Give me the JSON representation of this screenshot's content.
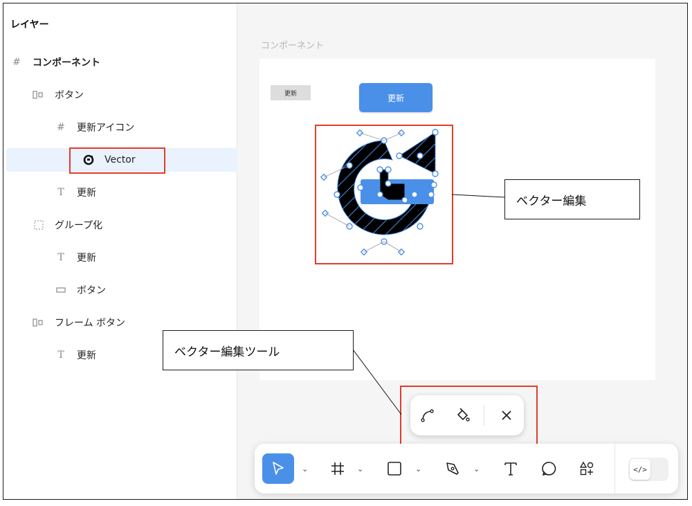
{
  "layers_panel": {
    "title": "レイヤー",
    "items": [
      {
        "label": "コンポーネント",
        "icon": "frame-icon"
      },
      {
        "label": "ボタン",
        "icon": "auto-layout-icon"
      },
      {
        "label": "更新アイコン",
        "icon": "frame-icon"
      },
      {
        "label": "Vector",
        "icon": "vector-icon"
      },
      {
        "label": "更新",
        "icon": "text-icon"
      },
      {
        "label": "グループ化",
        "icon": "group-icon"
      },
      {
        "label": "更新",
        "icon": "text-icon"
      },
      {
        "label": "ボタン",
        "icon": "rectangle-icon"
      },
      {
        "label": "フレーム ボタン",
        "icon": "auto-layout-icon"
      },
      {
        "label": "更新",
        "icon": "text-icon"
      }
    ]
  },
  "canvas": {
    "frame_label": "コンポーネント",
    "mini_button_label": "更新",
    "button_label": "更新"
  },
  "annotations": {
    "vector_edit": "ベクター編集",
    "vector_edit_tool": "ベクター編集ツール"
  },
  "vector_tools": [
    "bend-tool-icon",
    "paint-bucket-icon",
    "close-icon"
  ],
  "toolbar": {
    "tools": [
      "move-icon",
      "frame-icon",
      "rectangle-icon",
      "pen-icon",
      "text-icon",
      "comment-icon",
      "actions-icon"
    ],
    "dev_mode_label": "</>"
  },
  "colors": {
    "accent": "#4a90e8",
    "annotation_red": "#e03c2b",
    "selection_bg": "#e9f2fd"
  }
}
